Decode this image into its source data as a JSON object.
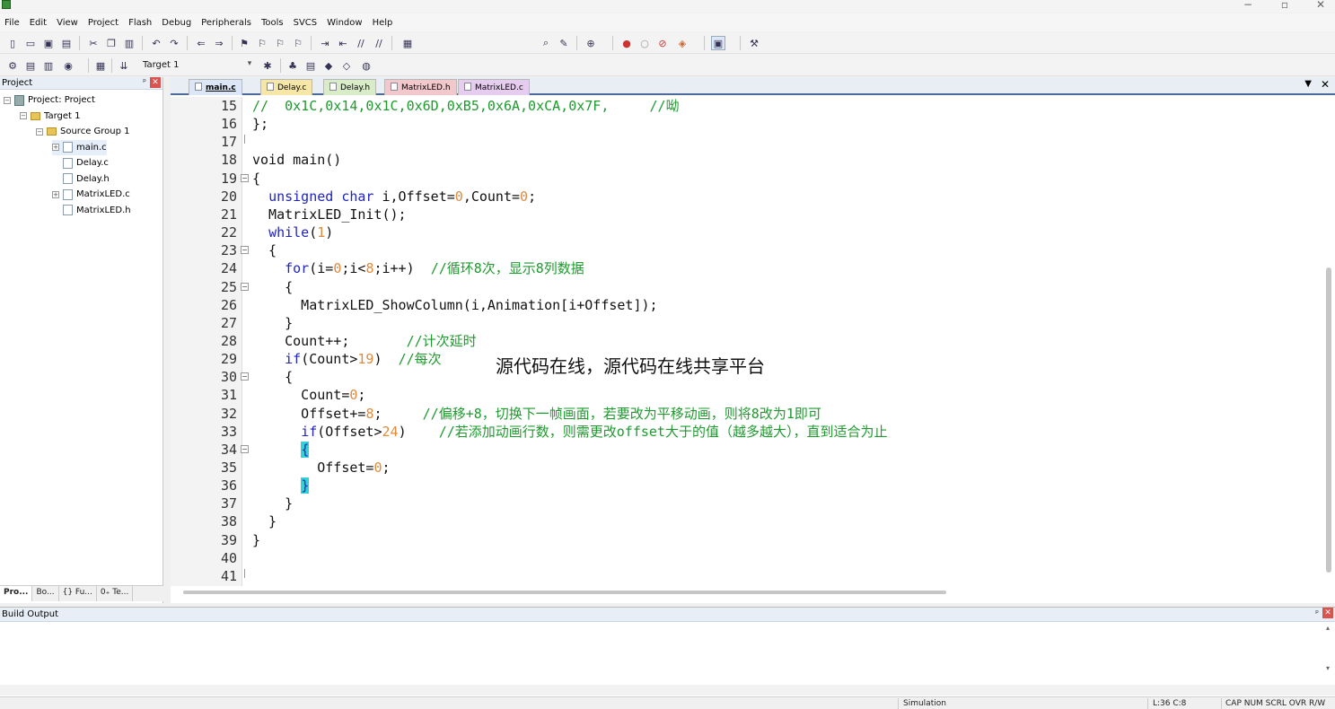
{
  "window": {
    "minimize": "−",
    "restore": "▫",
    "close": "✕"
  },
  "menu": [
    "File",
    "Edit",
    "View",
    "Project",
    "Flash",
    "Debug",
    "Peripherals",
    "Tools",
    "SVCS",
    "Window",
    "Help"
  ],
  "toolbar2": {
    "target": "Target 1"
  },
  "project_panel": {
    "title": "Project",
    "pin": "ᵖ",
    "close": "✕",
    "tree": [
      {
        "label": "Project: Project",
        "indent": 0,
        "toggle": "−",
        "icon": "proj"
      },
      {
        "label": "Target 1",
        "indent": 1,
        "toggle": "−",
        "icon": "folder"
      },
      {
        "label": "Source Group 1",
        "indent": 2,
        "toggle": "−",
        "icon": "folder"
      },
      {
        "label": "main.c",
        "indent": 3,
        "toggle": "+",
        "icon": "file"
      },
      {
        "label": "Delay.c",
        "indent": 3,
        "toggle": "",
        "icon": "file"
      },
      {
        "label": "Delay.h",
        "indent": 3,
        "toggle": "",
        "icon": "file"
      },
      {
        "label": "MatrixLED.c",
        "indent": 3,
        "toggle": "+",
        "icon": "file"
      },
      {
        "label": "MatrixLED.h",
        "indent": 3,
        "toggle": "",
        "icon": "file"
      }
    ],
    "bottom_tabs": [
      "Pro...",
      "Bo...",
      "{} Fu...",
      "0₊ Te..."
    ]
  },
  "editor": {
    "tabs": [
      {
        "label": "main.c",
        "color": "#dbe7f7",
        "active": true
      },
      {
        "label": "Delay.c",
        "color": "#f6e7a6",
        "active": false
      },
      {
        "label": "Delay.h",
        "color": "#d9ecc8",
        "active": false
      },
      {
        "label": "MatrixLED.h",
        "color": "#f2c8cc",
        "active": false
      },
      {
        "label": "MatrixLED.c",
        "color": "#e6cdef",
        "active": false
      }
    ],
    "dropdown": "▼",
    "close": "✕",
    "lines": [
      {
        "n": "15",
        "fold": "",
        "code": [
          [
            "cm",
            "//  0x1C,0x14,0x1C,0x6D,0xB5,0x6A,0xCA,0x7F,     //呦"
          ]
        ]
      },
      {
        "n": "16",
        "fold": "",
        "code": [
          [
            "",
            "};"
          ]
        ]
      },
      {
        "n": "17",
        "fold": "end",
        "code": []
      },
      {
        "n": "18",
        "fold": "",
        "code": [
          [
            "",
            "void main()"
          ]
        ]
      },
      {
        "n": "19",
        "fold": "open",
        "code": [
          [
            "",
            "{"
          ]
        ]
      },
      {
        "n": "20",
        "fold": "",
        "code": [
          [
            "",
            "  "
          ],
          [
            "kw",
            "unsigned char"
          ],
          [
            "",
            " i,Offset="
          ],
          [
            "num",
            "0"
          ],
          [
            "",
            ",Count="
          ],
          [
            "num",
            "0"
          ],
          [
            "",
            ";"
          ]
        ]
      },
      {
        "n": "21",
        "fold": "",
        "code": [
          [
            "",
            "  MatrixLED_Init();"
          ]
        ]
      },
      {
        "n": "22",
        "fold": "",
        "code": [
          [
            "",
            "  "
          ],
          [
            "kw",
            "while"
          ],
          [
            "",
            "("
          ],
          [
            "num",
            "1"
          ],
          [
            "",
            ")"
          ]
        ]
      },
      {
        "n": "23",
        "fold": "open",
        "code": [
          [
            "",
            "  {"
          ]
        ]
      },
      {
        "n": "24",
        "fold": "",
        "code": [
          [
            "",
            "    "
          ],
          [
            "kw",
            "for"
          ],
          [
            "",
            "(i="
          ],
          [
            "num",
            "0"
          ],
          [
            "",
            ";i<"
          ],
          [
            "num",
            "8"
          ],
          [
            "",
            ";i++)  "
          ],
          [
            "cm",
            "//循环8次，显示8列数据"
          ]
        ]
      },
      {
        "n": "25",
        "fold": "open",
        "code": [
          [
            "",
            "    {"
          ]
        ]
      },
      {
        "n": "26",
        "fold": "",
        "code": [
          [
            "",
            "      MatrixLED_ShowColumn(i,Animation[i+Offset]);"
          ]
        ]
      },
      {
        "n": "27",
        "fold": "",
        "code": [
          [
            "",
            "    }"
          ]
        ]
      },
      {
        "n": "28",
        "fold": "",
        "code": [
          [
            "",
            "    Count++;       "
          ],
          [
            "cm",
            "//计次延时"
          ]
        ]
      },
      {
        "n": "29",
        "fold": "",
        "code": [
          [
            "",
            "    "
          ],
          [
            "kw",
            "if"
          ],
          [
            "",
            "(Count>"
          ],
          [
            "num",
            "19"
          ],
          [
            "",
            ")  "
          ],
          [
            "cm",
            "//每次"
          ]
        ]
      },
      {
        "n": "30",
        "fold": "open",
        "code": [
          [
            "",
            "    {"
          ]
        ]
      },
      {
        "n": "31",
        "fold": "",
        "code": [
          [
            "",
            "      Count="
          ],
          [
            "num",
            "0"
          ],
          [
            "",
            ";"
          ]
        ]
      },
      {
        "n": "32",
        "fold": "",
        "code": [
          [
            "",
            "      Offset+="
          ],
          [
            "num",
            "8"
          ],
          [
            "",
            ";     "
          ],
          [
            "cm",
            "//偏移+8，切换下一帧画面，若要改为平移动画，则将8改为1即可"
          ]
        ]
      },
      {
        "n": "33",
        "fold": "",
        "code": [
          [
            "",
            "      "
          ],
          [
            "kw",
            "if"
          ],
          [
            "",
            "(Offset>"
          ],
          [
            "num",
            "24"
          ],
          [
            "",
            ")    "
          ],
          [
            "cm",
            "//若添加动画行数，则需更改offset大于的值（越多越大），直到适合为止"
          ]
        ]
      },
      {
        "n": "34",
        "fold": "open",
        "code": [
          [
            "",
            "      "
          ],
          [
            "hl",
            "{"
          ]
        ]
      },
      {
        "n": "35",
        "fold": "",
        "code": [
          [
            "",
            "        Offset="
          ],
          [
            "num",
            "0"
          ],
          [
            "",
            ";"
          ]
        ]
      },
      {
        "n": "36",
        "fold": "",
        "code": [
          [
            "",
            "      "
          ],
          [
            "hl",
            "}"
          ]
        ]
      },
      {
        "n": "37",
        "fold": "",
        "code": [
          [
            "",
            "    }"
          ]
        ]
      },
      {
        "n": "38",
        "fold": "",
        "code": [
          [
            "",
            "  }"
          ]
        ]
      },
      {
        "n": "39",
        "fold": "",
        "code": [
          [
            "",
            "}"
          ]
        ]
      },
      {
        "n": "40",
        "fold": "",
        "code": []
      },
      {
        "n": "41",
        "fold": "end",
        "code": []
      }
    ]
  },
  "watermark": "源代码在线，源代码在线共享平台",
  "build_output": {
    "title": "Build Output",
    "pin": "ᵖ",
    "close": "✕"
  },
  "status": {
    "mode": "Simulation",
    "position": "L:36 C:8",
    "flags": "CAP  NUM  SCRL  OVR  R/W"
  },
  "colors": {
    "accent": "#4b6b9a",
    "keyword": "#1f24c2",
    "number": "#e08a3c",
    "comment": "#1e9a2e",
    "brace_highlight": "#33d1d6"
  }
}
